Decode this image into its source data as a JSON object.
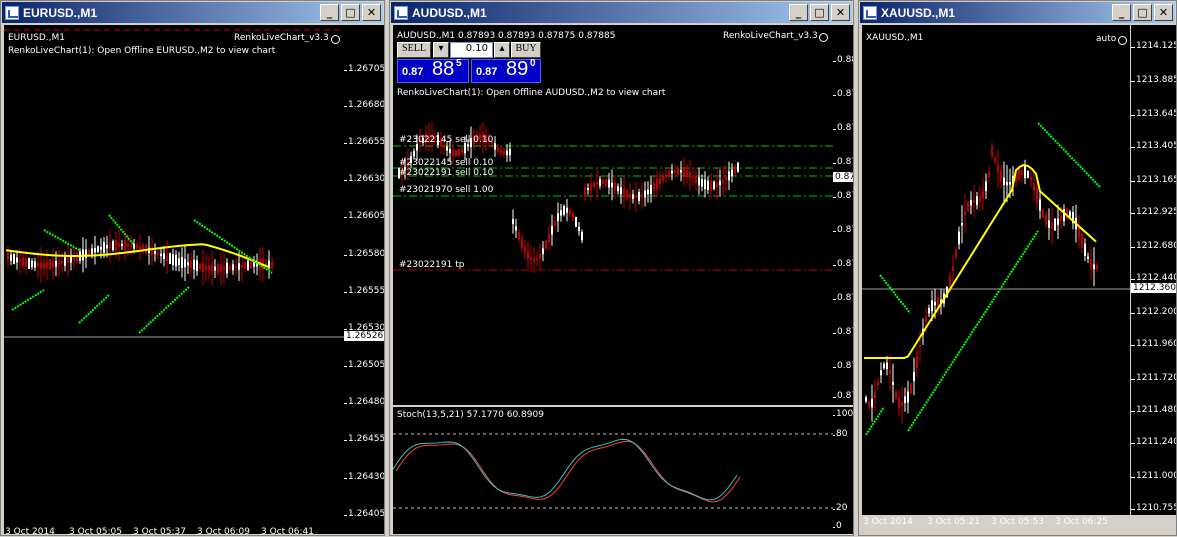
{
  "windows": [
    {
      "title": "EURUSD.,M1",
      "symbol_label": "EURUSD.,M1",
      "indicator_name": "RenkoLiveChart_v3.3",
      "message": "RenkoLiveChart(1): Open Offline EURUSD.,M2 to view chart",
      "price_ticks": [
        "1.26705",
        "1.26680",
        "1.26655",
        "1.26630",
        "1.26605",
        "1.26580",
        "1.26555",
        "1.26530",
        "1.26505",
        "1.26480",
        "1.26455",
        "1.26430",
        "1.26405"
      ],
      "current_price": "1.26526",
      "time_labels": [
        "3 Oct 2014",
        "3 Oct 05:05",
        "3 Oct 05:37",
        "3 Oct 06:09",
        "3 Oct 06:41"
      ]
    },
    {
      "title": "AUDUSD.,M1",
      "symbol_label": "AUDUSD.,M1  0.87893 0.87893 0.87875 0.87885",
      "indicator_name": "RenkoLiveChart_v3.3",
      "message": "RenkoLiveChart(1): Open Offline AUDUSD.,M2 to view chart",
      "sell_label": "SELL",
      "buy_label": "BUY",
      "lot_value": "0.10",
      "sell_price_small": "0.87",
      "sell_price_big": "88",
      "sell_price_sup": "5",
      "buy_price_small": "0.87",
      "buy_price_big": "89",
      "buy_price_sup": "0",
      "orders": [
        "#23022145 sell 0.10",
        "#23022145 sell 0.10",
        "#23022191 sell 0.10",
        "#23021970 sell 1.00"
      ],
      "tp_label": "#23022191 tp",
      "price_ticks": [
        "0.88",
        "0.87",
        "0.87",
        "0.87",
        "0.87",
        "0.87",
        "0.87",
        "0.87",
        "0.87",
        "0.87",
        "0.87"
      ],
      "current_price": "0.87",
      "stoch_label": "Stoch(13,5,21) 57.1770 60.8909",
      "stoch_ticks": [
        "100",
        "80",
        "20",
        "0"
      ]
    },
    {
      "title": "XAUUSD.,M1",
      "symbol_label": "XAUUSD.,M1",
      "auto_label": "auto",
      "price_ticks": [
        "1214.125",
        "1213.885",
        "1213.645",
        "1213.405",
        "1213.165",
        "1212.925",
        "1212.680",
        "1212.440",
        "1212.200",
        "1211.960",
        "1211.720",
        "1211.480",
        "1211.240",
        "1211.000",
        "1210.755"
      ],
      "current_price": "1212.360",
      "time_labels": [
        "3 Oct 2014",
        "3 Oct 05:21",
        "3 Oct 05:53",
        "3 Oct 06:25"
      ]
    }
  ],
  "colors": {
    "title_gradient_start": "#0a246a",
    "bull_candle": "#ffffff",
    "bear_candle": "#c00000",
    "ma_line": "#ffff00",
    "renko_dots": "#00ff00",
    "order_line": "#00c000",
    "tp_line": "#c00000",
    "stoch_main": "#40c0c0",
    "stoch_signal": "#ff4040"
  }
}
